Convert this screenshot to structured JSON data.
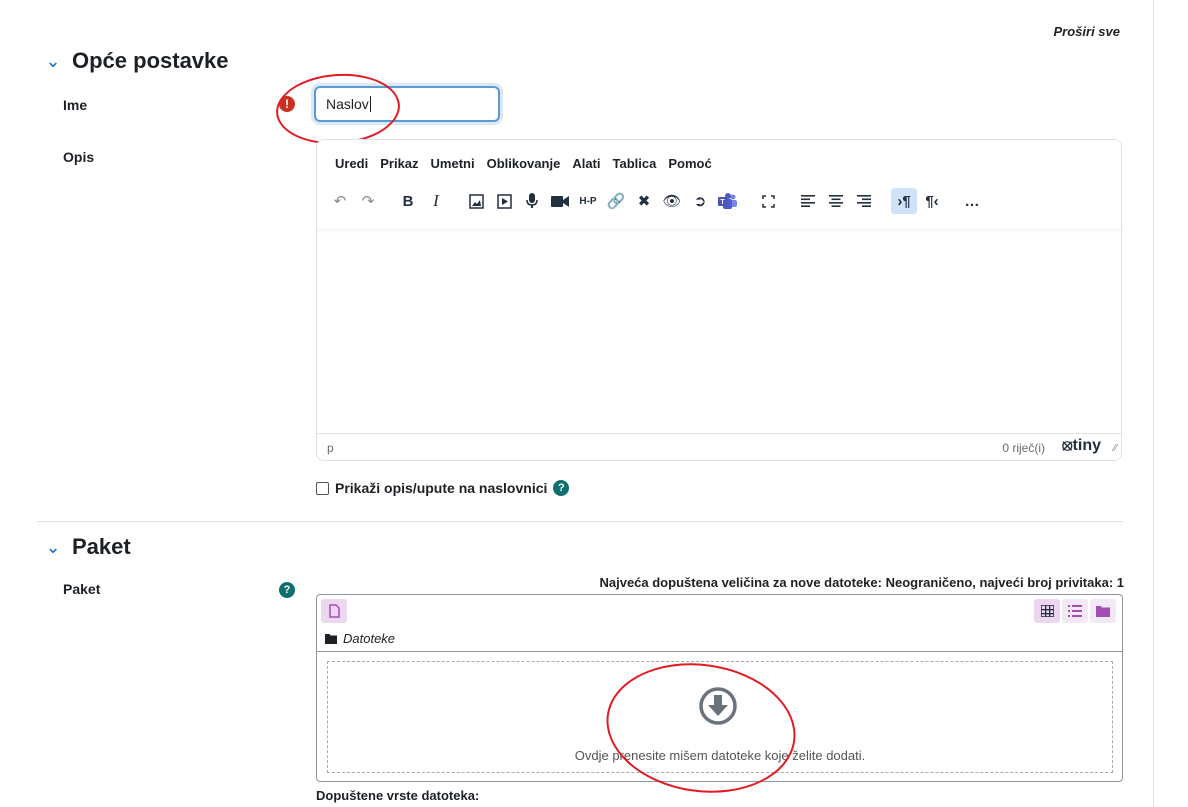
{
  "expand_all": "Proširi sve",
  "sections": {
    "general": {
      "title": "Opće postavke"
    },
    "package": {
      "title": "Paket"
    }
  },
  "fields": {
    "name": {
      "label": "Ime",
      "value": "Naslov",
      "required_icon": "exclamation-icon"
    },
    "description": {
      "label": "Opis"
    }
  },
  "editor": {
    "menu": [
      "Uredi",
      "Prikaz",
      "Umetni",
      "Oblikovanje",
      "Alati",
      "Tablica",
      "Pomoć"
    ],
    "toolbar_icons": [
      "undo-icon",
      "redo-icon",
      "bold-icon",
      "italic-icon",
      "image-icon",
      "media-icon",
      "record-audio-icon",
      "record-video-icon",
      "h5p-icon",
      "link-icon",
      "unlink-icon",
      "accessibility-checker-icon",
      "screen-reader-helper-icon",
      "teams-icon",
      "fullscreen-icon",
      "align-left-icon",
      "align-center-icon",
      "align-right-icon",
      "ltr-icon",
      "rtl-icon",
      "more-icon"
    ],
    "status_path": "p",
    "word_count": "0 riječ(i)",
    "brand": "tiny"
  },
  "show_description": {
    "label": "Prikaži opis/upute na naslovnici",
    "checked": false
  },
  "package": {
    "label": "Paket",
    "max_size_info": "Najveća dopuštena veličina za nove datoteke: Neograničeno, najveći broj privitaka: 1",
    "folder_label": "Datoteke",
    "drop_text": "Ovdje prenesite mišem datoteke koje želite dodati.",
    "allowed_types_label": "Dopuštene vrste datoteka:"
  },
  "colors": {
    "accent": "#0f6cbf",
    "error": "#ca3120",
    "help": "#0f6f6f",
    "annotation": "#e01b24",
    "fm_accent": "#c9a0d3"
  }
}
